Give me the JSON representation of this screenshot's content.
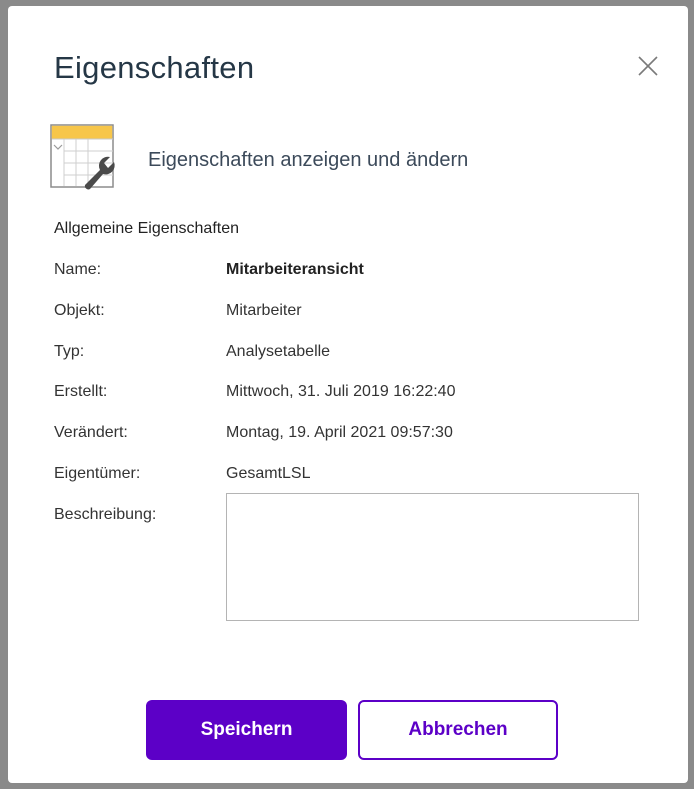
{
  "dialog": {
    "title": "Eigenschaften",
    "subtitle": "Eigenschaften anzeigen und ändern",
    "section_title": "Allgemeine Eigenschaften",
    "properties": {
      "name": {
        "label": "Name:",
        "value": "Mitarbeiteransicht"
      },
      "object": {
        "label": "Objekt:",
        "value": "Mitarbeiter"
      },
      "type": {
        "label": "Typ:",
        "value": "Analysetabelle"
      },
      "created": {
        "label": "Erstellt:",
        "value": "Mittwoch, 31. Juli 2019 16:22:40"
      },
      "modified": {
        "label": "Verändert:",
        "value": "Montag, 19. April 2021 09:57:30"
      },
      "owner": {
        "label": "Eigentümer:",
        "value": "GesamtLSL"
      }
    },
    "description": {
      "label": "Beschreibung:",
      "value": ""
    },
    "buttons": {
      "save": "Speichern",
      "cancel": "Abbrechen"
    }
  },
  "colors": {
    "accent": "#5c00c7",
    "title": "#253746",
    "overlay": "#8a8a8a"
  },
  "icons": {
    "close": "close-icon",
    "hero": "table-properties-icon"
  }
}
